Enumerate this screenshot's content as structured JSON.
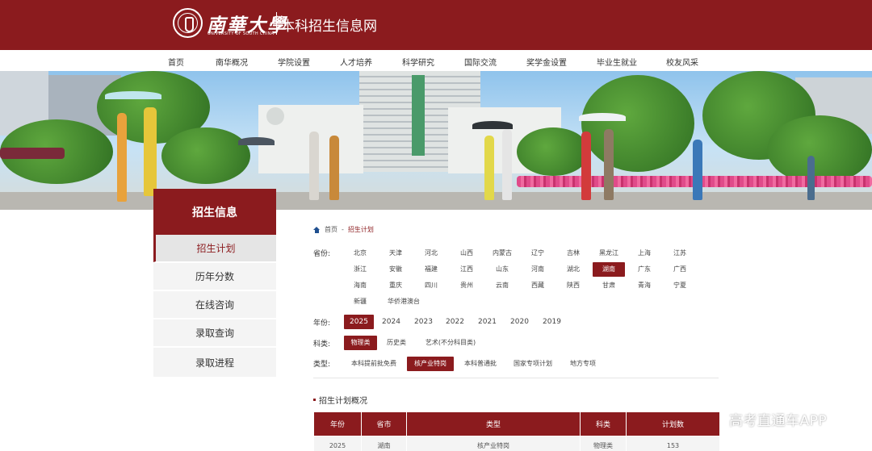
{
  "header": {
    "logo_cn": "南華大學",
    "logo_en": "UNIVERSITY OF SOUTH CHINA",
    "site_title": "本科招生信息网"
  },
  "nav": [
    "首页",
    "南华概况",
    "学院设置",
    "人才培养",
    "科学研究",
    "国际交流",
    "奖学金设置",
    "毕业生就业",
    "校友风采"
  ],
  "sidebar": {
    "title": "招生信息",
    "items": [
      {
        "label": "招生计划",
        "active": true
      },
      {
        "label": "历年分数",
        "active": false
      },
      {
        "label": "在线咨询",
        "active": false
      },
      {
        "label": "录取查询",
        "active": false
      },
      {
        "label": "录取进程",
        "active": false
      }
    ]
  },
  "breadcrumb": {
    "home": "首页",
    "sep": "-",
    "current": "招生计划"
  },
  "filters": {
    "province": {
      "label": "省份:",
      "options": [
        "北京",
        "天津",
        "河北",
        "山西",
        "内蒙古",
        "辽宁",
        "吉林",
        "黑龙江",
        "上海",
        "江苏",
        "浙江",
        "安徽",
        "福建",
        "江西",
        "山东",
        "河南",
        "湖北",
        "湖南",
        "广东",
        "广西",
        "海南",
        "重庆",
        "四川",
        "贵州",
        "云南",
        "西藏",
        "陕西",
        "甘肃",
        "青海",
        "宁夏",
        "新疆",
        "华侨港澳台"
      ],
      "selected": "湖南"
    },
    "year": {
      "label": "年份:",
      "options": [
        "2025",
        "2024",
        "2023",
        "2022",
        "2021",
        "2020",
        "2019"
      ],
      "selected": "2025"
    },
    "subject": {
      "label": "科类:",
      "options": [
        "物理类",
        "历史类",
        "艺术(不分科目类)"
      ],
      "selected": "物理类"
    },
    "type": {
      "label": "类型:",
      "options": [
        "本科提前批免费",
        "核产业特岗",
        "本科普通批",
        "国家专项计划",
        "地方专项"
      ],
      "selected": "核产业特岗"
    }
  },
  "section_title": "招生计划概况",
  "table": {
    "headers": [
      "年份",
      "省市",
      "类型",
      "科类",
      "计划数"
    ],
    "rows": [
      [
        "2025",
        "湖南",
        "核产业特岗",
        "物理类",
        "153"
      ]
    ]
  },
  "watermark": "高考直通车APP",
  "colors": {
    "brand": "#8b1b1e"
  }
}
